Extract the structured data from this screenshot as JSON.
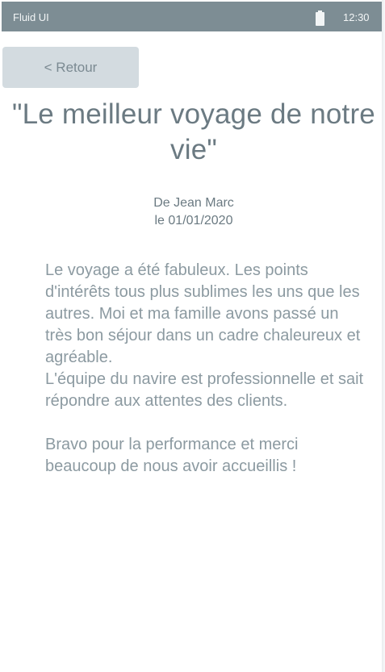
{
  "status_bar": {
    "app_name": "Fluid UI",
    "battery_icon": "battery-full-icon",
    "time": "12:30"
  },
  "back_button": {
    "label": "< Retour"
  },
  "review": {
    "title": "\"Le meilleur voyage de notre vie\"",
    "author_line": "De Jean Marc",
    "date_line": "le 01/01/2020",
    "paragraphs": [
      "Le voyage a été fabuleux. Les points d'intérêts tous plus sublimes les uns que les autres. Moi et ma famille avons passé un très bon séjour dans un cadre chaleureux et agréable.\nL'équipe du navire est professionnelle et sait répondre aux attentes des clients.",
      "Bravo pour la performance et merci beaucoup de nous avoir accueillis !"
    ]
  },
  "colors": {
    "status_bar": "#7d8d94",
    "button": "#d3dbe0",
    "title_text": "#6b7a82",
    "body_text": "#8c9aa1"
  }
}
